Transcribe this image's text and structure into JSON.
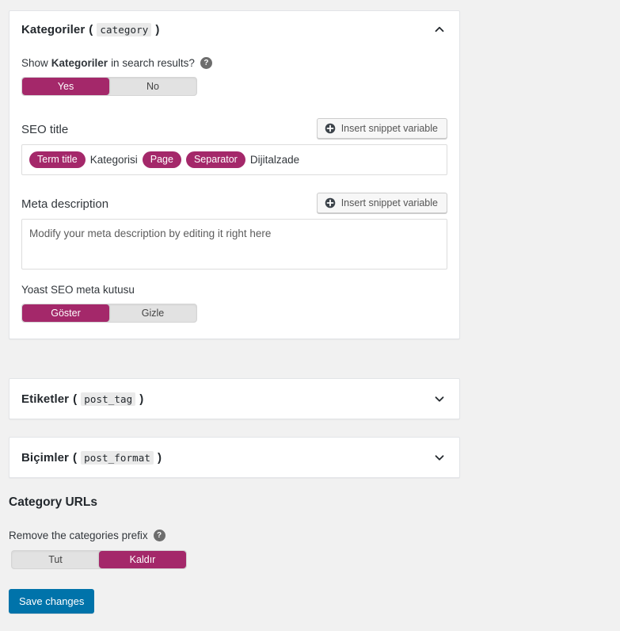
{
  "panels": [
    {
      "title": "Kategoriler",
      "code": "category",
      "open_paren": "(",
      "close_paren": ")",
      "chevron": "chevron-up-icon",
      "expanded": true
    },
    {
      "title": "Etiketler",
      "code": "post_tag",
      "open_paren": "(",
      "close_paren": ")",
      "chevron": "chevron-down-icon",
      "expanded": false
    },
    {
      "title": "Biçimler",
      "code": "post_format",
      "open_paren": "(",
      "close_paren": ")",
      "chevron": "chevron-down-icon",
      "expanded": false
    }
  ],
  "search_results": {
    "label_prefix": "Show",
    "label_strong": "Kategoriler",
    "label_suffix": "in search results?",
    "help_icon": "help-icon",
    "help_glyph": "?",
    "options": [
      "Yes",
      "No"
    ],
    "active": "Yes"
  },
  "seo_title": {
    "label": "SEO title",
    "insert_button": "Insert snippet variable",
    "insert_icon": "plus-circle-icon",
    "parts": [
      {
        "type": "pill",
        "text": "Term title"
      },
      {
        "type": "text",
        "text": "Kategorisi"
      },
      {
        "type": "pill",
        "text": "Page"
      },
      {
        "type": "pill",
        "text": "Separator"
      },
      {
        "type": "text",
        "text": "Dijitalzade"
      }
    ]
  },
  "meta_description": {
    "label": "Meta description",
    "insert_button": "Insert snippet variable",
    "insert_icon": "plus-circle-icon",
    "placeholder": "Modify your meta description by editing it right here",
    "value": ""
  },
  "yoast_metabox": {
    "label": "Yoast SEO meta kutusu",
    "options": [
      "Göster",
      "Gizle"
    ],
    "active": "Göster"
  },
  "category_urls": {
    "heading": "Category URLs",
    "label": "Remove the categories prefix",
    "help_icon": "help-icon",
    "help_glyph": "?",
    "options": [
      "Tut",
      "Kaldır"
    ],
    "active": "Kaldır"
  },
  "save": {
    "label": "Save changes"
  },
  "colors": {
    "accent": "#a4286a",
    "primary_button": "#0073aa",
    "page_background": "#f1f1f1",
    "panel_background": "#ffffff",
    "border": "#e2e4e7"
  }
}
